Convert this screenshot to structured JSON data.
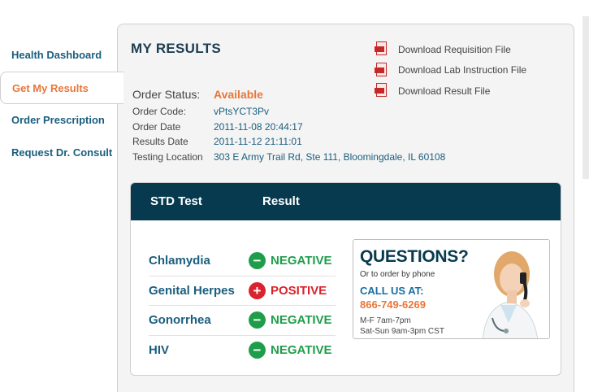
{
  "sidebar": {
    "items": [
      {
        "label": "Health Dashboard"
      },
      {
        "label": "Get My Results"
      },
      {
        "label": "Order Prescription"
      },
      {
        "label": "Request Dr. Consult"
      }
    ]
  },
  "page": {
    "title": "MY RESULTS"
  },
  "downloads": [
    {
      "label": "Download Requisition File",
      "icon": "pdf-icon"
    },
    {
      "label": "Download Lab Instruction File",
      "icon": "pdf-icon"
    },
    {
      "label": "Download Result File",
      "icon": "pdf-icon"
    }
  ],
  "order": {
    "status_label": "Order Status:",
    "status_value": "Available",
    "code_label": "Order Code:",
    "code_value": "vPtsYCT3Pv",
    "date_label": "Order Date",
    "date_value": "2011-11-08 20:44:17",
    "results_label": "Results Date",
    "results_value": "2011-11-12 21:11:01",
    "location_label": "Testing Location",
    "location_value": "303 E Army Trail Rd, Ste 111, Bloomingdale, IL 60108"
  },
  "results": {
    "col_test": "STD Test",
    "col_result": "Result",
    "rows": [
      {
        "test": "Chlamydia",
        "symbol": "−",
        "result": "NEGATIVE"
      },
      {
        "test": "Genital Herpes",
        "symbol": "+",
        "result": "POSITIVE"
      },
      {
        "test": "Gonorrhea",
        "symbol": "−",
        "result": "NEGATIVE"
      },
      {
        "test": "HIV",
        "symbol": "−",
        "result": "NEGATIVE"
      }
    ]
  },
  "ad": {
    "headline": "QUESTIONS?",
    "sub": "Or to order by phone",
    "call": "CALL US AT:",
    "phone": "866-749-6269",
    "hours_1": "M-F 7am-7pm",
    "hours_2": "Sat-Sun 9am-3pm CST"
  },
  "colors": {
    "accent_orange": "#e8763a",
    "link_blue": "#1a5e7e",
    "header_dark": "#073a4e",
    "negative_green": "#1e9e4a",
    "positive_red": "#d9232d"
  }
}
